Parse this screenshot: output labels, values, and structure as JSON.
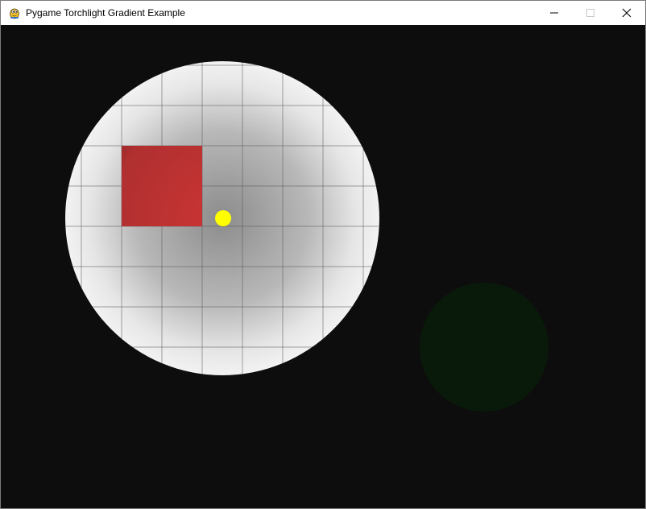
{
  "window": {
    "title": "Pygame Torchlight Gradient Example",
    "app_icon": "pygame-snake-icon",
    "controls": {
      "minimize_icon": "minimize-icon",
      "maximize_icon": "maximize-icon",
      "close_icon": "close-icon"
    }
  },
  "colors": {
    "background": "#0d0d0d",
    "grid_line": "#3a3a3a",
    "light_center": "#8c8c8c",
    "light_edge": "#f2f2f2",
    "red_block": "#c83232",
    "green_orb": "#0a1a0a",
    "player": "#ffff00"
  }
}
